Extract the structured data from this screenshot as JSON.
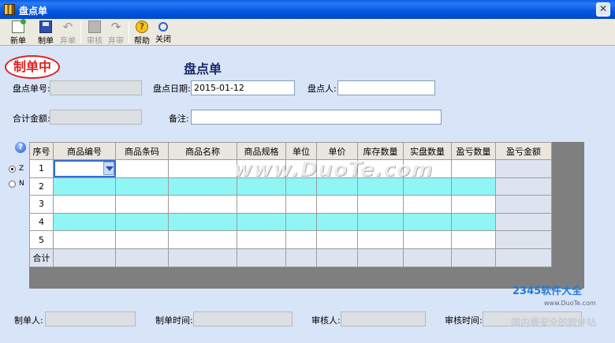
{
  "window": {
    "title": "盘点单",
    "close_glyph": "✕"
  },
  "toolbar": {
    "new": "新单",
    "save": "制单",
    "abandon": "弃单",
    "audit": "审核",
    "unaudit": "弃审",
    "help": "帮助",
    "close": "关闭",
    "help_glyph": "?"
  },
  "form": {
    "status": "制单中",
    "title": "盘点单",
    "order_no_label": "盘点单号:",
    "order_no": "",
    "date_label": "盘点日期:",
    "date": "2015-01-12",
    "counter_label": "盘点人:",
    "counter": "",
    "total_label": "合计金额:",
    "total": "",
    "remark_label": "备注:",
    "remark": ""
  },
  "side": {
    "help_glyph": "?",
    "radio_z": "Z",
    "radio_n": "N"
  },
  "grid": {
    "headers": [
      "序号",
      "商品编号",
      "商品条码",
      "商品名称",
      "商品规格",
      "单位",
      "单价",
      "库存数量",
      "实盘数量",
      "盈亏数量",
      "盈亏金额"
    ],
    "rows": [
      "1",
      "2",
      "3",
      "4",
      "5"
    ],
    "total_label": "合计"
  },
  "footer": {
    "maker_label": "制单人:",
    "maker": "",
    "make_time_label": "制单时间:",
    "make_time": "",
    "auditor_label": "审核人:",
    "auditor": "",
    "audit_time_label": "审核时间:",
    "audit_time": ""
  },
  "watermarks": {
    "duote": "www.DuoTe.com",
    "brand": "2345软件大全",
    "url": "www.DuoTe.com",
    "slogan": "国内最安全的软件站"
  }
}
